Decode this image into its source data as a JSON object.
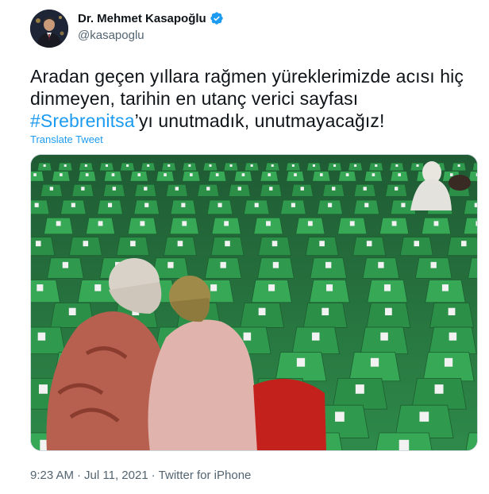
{
  "author": {
    "display_name": "Dr. Mehmet Kasapoğlu",
    "handle": "@kasapoglu",
    "verified_icon": "verified-badge-icon"
  },
  "tweet": {
    "text_before": "Aradan geçen yıllara rağmen yüreklerimizde acısı hiç dinmeyen, tarihin en utanç verici sayfası ",
    "hashtag": "#Srebrenitsa",
    "text_after": "’yı unutmadık, unutmayacağız!",
    "translate_label": "Translate Tweet"
  },
  "meta": {
    "time": "9:23 AM",
    "separator1": "·",
    "date": "Jul 11, 2021",
    "separator2": "·",
    "source": "Twitter for iPhone"
  },
  "colors": {
    "link": "#1d9bf0",
    "text": "#0f1419",
    "secondary": "#536471"
  }
}
